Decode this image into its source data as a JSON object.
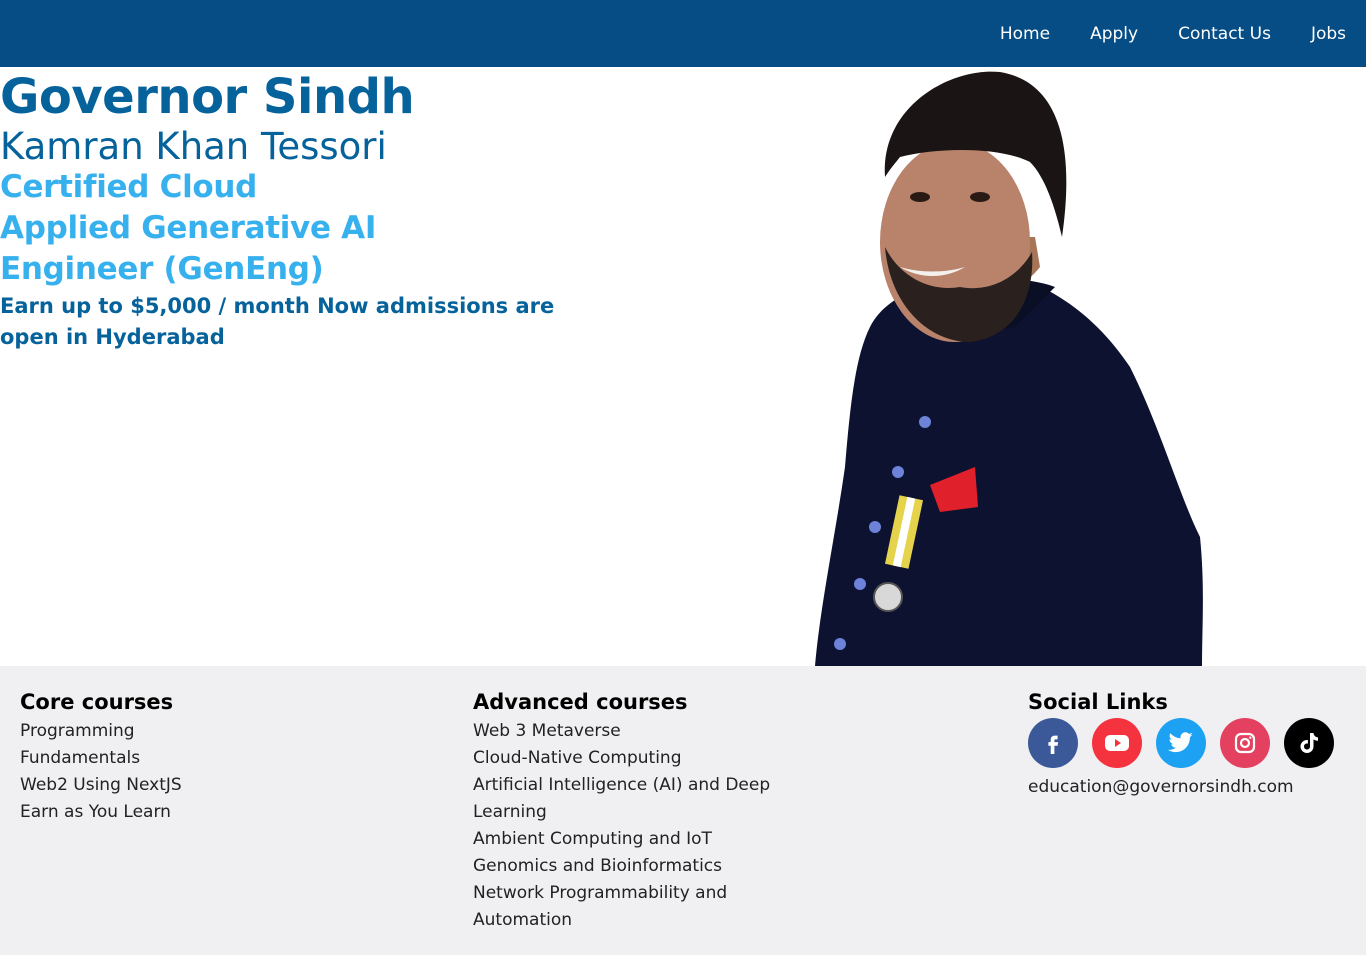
{
  "nav": {
    "links": [
      "Home",
      "Apply",
      "Contact Us",
      "Jobs"
    ]
  },
  "hero": {
    "title": "Governor Sindh",
    "name": "Kamran Khan Tessori",
    "line1": "Certified Cloud",
    "line2": "Applied Generative AI",
    "line3": "Engineer (GenEng)",
    "earn": "Earn up to $5,000 / month Now admissions are open in Hyderabad"
  },
  "footer": {
    "core": {
      "heading": "Core courses",
      "items": [
        "Programming",
        "Fundamentals",
        "Web2 Using NextJS",
        "Earn as You Learn"
      ]
    },
    "advanced": {
      "heading": "Advanced courses",
      "items": [
        "Web 3 Metaverse",
        "Cloud-Native Computing",
        "Artificial Intelligence (AI) and Deep Learning",
        "Ambient Computing and IoT",
        "Genomics and Bioinformatics",
        "Network Programmability and Automation"
      ]
    },
    "social": {
      "heading": "Social Links",
      "icons": [
        {
          "name": "facebook-icon",
          "color": "#3b5998"
        },
        {
          "name": "youtube-icon",
          "color": "#f5333f"
        },
        {
          "name": "twitter-icon",
          "color": "#1da1f2"
        },
        {
          "name": "instagram-icon",
          "color": "#e4405f"
        },
        {
          "name": "tiktok-icon",
          "color": "#000000"
        }
      ],
      "email": "education@governorsindh.com"
    }
  }
}
